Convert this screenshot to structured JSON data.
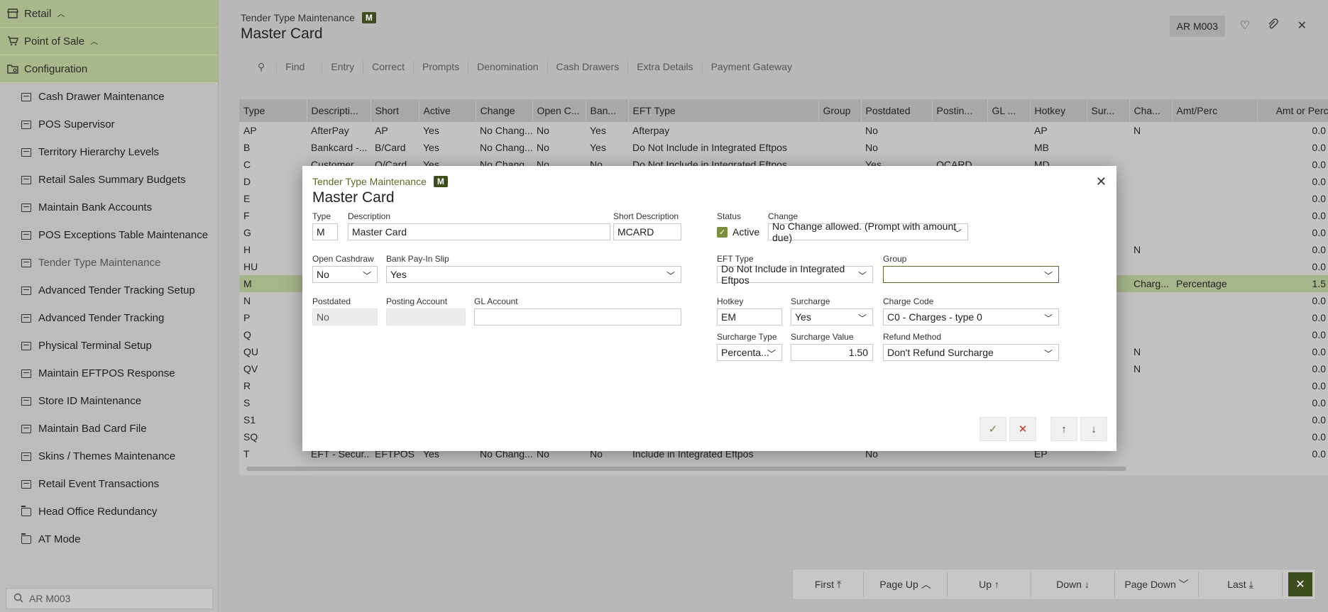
{
  "sidebar": {
    "groups": [
      {
        "label": "Retail",
        "icon": "store-icon",
        "chevron": "^"
      },
      {
        "label": "Point of Sale",
        "icon": "cart-icon",
        "chevron": "^"
      },
      {
        "label": "Configuration",
        "icon": "folder-gear-icon",
        "chevron": ""
      }
    ],
    "items": [
      "Cash Drawer Maintenance",
      "POS Supervisor",
      "Territory Hierarchy Levels",
      "Retail Sales Summary Budgets",
      "Maintain Bank Accounts",
      "POS Exceptions Table Maintenance",
      "Tender Type Maintenance",
      "Advanced Tender Tracking Setup",
      "Advanced Tender Tracking",
      "Physical Terminal Setup",
      "Maintain EFTPOS Response",
      "Store ID Maintenance",
      "Maintain Bad Card File",
      "Skins / Themes Maintenance",
      "Retail Event Transactions",
      "Head Office Redundancy",
      "AT Mode"
    ],
    "search_value": "AR M003"
  },
  "header": {
    "subtitle": "Tender Type Maintenance",
    "badge": "M",
    "title": "Master Card",
    "user": "AR M003"
  },
  "toolbar": [
    "Find",
    "Entry",
    "Correct",
    "Prompts",
    "Denomination",
    "Cash Drawers",
    "Extra Details",
    "Payment Gateway"
  ],
  "table": {
    "columns": [
      "Type",
      "Descripti...",
      "Short",
      "Active",
      "Change",
      "Open C...",
      "Ban...",
      "EFT Type",
      "Group",
      "Postdated",
      "Postin...",
      "GL ...",
      "Hotkey",
      "Sur...",
      "Cha...",
      "Amt/Perc",
      "Amt or Perc"
    ],
    "rows": [
      [
        "AP",
        "AfterPay",
        "AP",
        "Yes",
        "No Chang...",
        "No",
        "Yes",
        "Afterpay",
        "",
        "No",
        "",
        "",
        "AP",
        "",
        "N",
        "",
        "0.0"
      ],
      [
        "B",
        "Bankcard -...",
        "B/Card",
        "Yes",
        "No Chang...",
        "No",
        "Yes",
        "Do Not Include in Integrated Eftpos",
        "",
        "No",
        "",
        "",
        "MB",
        "",
        "",
        "",
        "0.0"
      ],
      [
        "C",
        "Customer...",
        "O/Card",
        "Yes",
        "No Chang...",
        "No",
        "No",
        "Do Not Include in Integrated Eftpos",
        "",
        "Yes",
        "OCARD",
        "",
        "MD",
        "",
        "",
        "",
        "0.0"
      ],
      [
        "D",
        "",
        "",
        "",
        "",
        "",
        "",
        "",
        "",
        "",
        "",
        "",
        "",
        "",
        "",
        "",
        "0.0"
      ],
      [
        "E",
        "",
        "",
        "",
        "",
        "",
        "",
        "",
        "",
        "",
        "",
        "",
        "",
        "",
        "",
        "",
        "0.0"
      ],
      [
        "F",
        "",
        "",
        "",
        "",
        "",
        "",
        "",
        "",
        "",
        "",
        "",
        "",
        "",
        "",
        "",
        "0.0"
      ],
      [
        "G",
        "",
        "",
        "",
        "",
        "",
        "",
        "",
        "",
        "",
        "",
        "",
        "",
        "",
        "",
        "",
        "0.0"
      ],
      [
        "H",
        "",
        "",
        "",
        "",
        "",
        "",
        "",
        "",
        "",
        "",
        "",
        "",
        "",
        "N",
        "",
        "0.0"
      ],
      [
        "HU",
        "",
        "",
        "",
        "",
        "",
        "",
        "",
        "",
        "",
        "",
        "",
        "",
        "",
        "",
        "",
        "0.0"
      ],
      [
        "M",
        "",
        "",
        "",
        "",
        "",
        "",
        "",
        "",
        "",
        "",
        "",
        "",
        "",
        "Charg...",
        "Percentage",
        "1.5"
      ],
      [
        "N",
        "",
        "",
        "",
        "",
        "",
        "",
        "",
        "",
        "",
        "",
        "",
        "",
        "",
        "",
        "",
        "0.0"
      ],
      [
        "P",
        "",
        "",
        "",
        "",
        "",
        "",
        "",
        "",
        "",
        "",
        "",
        "",
        "",
        "",
        "",
        "0.0"
      ],
      [
        "Q",
        "",
        "",
        "",
        "",
        "",
        "",
        "",
        "",
        "",
        "",
        "",
        "",
        "",
        "",
        "",
        "0.0"
      ],
      [
        "QU",
        "",
        "",
        "",
        "",
        "",
        "",
        "",
        "",
        "",
        "",
        "",
        "",
        "",
        "N",
        "",
        "0.0"
      ],
      [
        "QV",
        "",
        "",
        "",
        "",
        "",
        "",
        "",
        "",
        "",
        "",
        "",
        "",
        "",
        "N",
        "",
        "0.0"
      ],
      [
        "R",
        "",
        "",
        "",
        "",
        "",
        "",
        "",
        "",
        "",
        "",
        "",
        "",
        "",
        "",
        "",
        "0.0"
      ],
      [
        "S",
        "",
        "",
        "",
        "",
        "",
        "",
        "",
        "",
        "",
        "",
        "",
        "",
        "",
        "",
        "",
        "0.0"
      ],
      [
        "S1",
        "",
        "",
        "",
        "",
        "",
        "",
        "",
        "",
        "",
        "",
        "",
        "",
        "",
        "",
        "",
        "0.0"
      ],
      [
        "SQ",
        "",
        "",
        "",
        "",
        "",
        "",
        "",
        "",
        "",
        "",
        "",
        "",
        "",
        "",
        "",
        "0.0"
      ],
      [
        "T",
        "EFT - Secur...",
        "EFTPOS",
        "Yes",
        "No Chang...",
        "No",
        "No",
        "Include in Integrated Eftpos",
        "",
        "No",
        "",
        "",
        "EP",
        "",
        "",
        "",
        "0.0"
      ]
    ],
    "selected_index": 9
  },
  "modal": {
    "subtitle": "Tender Type Maintenance",
    "badge": "M",
    "title": "Master Card",
    "fields": {
      "type": {
        "label": "Type",
        "value": "M"
      },
      "description": {
        "label": "Description",
        "value": "Master Card"
      },
      "short_description": {
        "label": "Short Description",
        "value": "MCARD"
      },
      "status": {
        "label": "Status",
        "value": "Active"
      },
      "change": {
        "label": "Change",
        "value": "No Change allowed. (Prompt with amount due)"
      },
      "open_cashdraw": {
        "label": "Open Cashdraw",
        "value": "No"
      },
      "bank_payin": {
        "label": "Bank Pay-In Slip",
        "value": "Yes"
      },
      "eft_type": {
        "label": "EFT Type",
        "value": "Do Not Include in Integrated Eftpos"
      },
      "group": {
        "label": "Group",
        "value": ""
      },
      "postdated": {
        "label": "Postdated",
        "value": "No"
      },
      "posting_account": {
        "label": "Posting Account",
        "value": ""
      },
      "gl_account": {
        "label": "GL Account",
        "value": ""
      },
      "hotkey": {
        "label": "Hotkey",
        "value": "EM"
      },
      "surcharge": {
        "label": "Surcharge",
        "value": "Yes"
      },
      "charge_code": {
        "label": "Charge Code",
        "value": "C0 - Charges - type 0"
      },
      "surcharge_type": {
        "label": "Surcharge Type",
        "value": "Percenta..."
      },
      "surcharge_value": {
        "label": "Surcharge Value",
        "value": "1.50"
      },
      "refund_method": {
        "label": "Refund Method",
        "value": "Don't Refund Surcharge"
      }
    }
  },
  "pager": [
    "First",
    "Page Up",
    "Up",
    "Down",
    "Page Down",
    "Last"
  ],
  "colors": {
    "accent": "#3d4d1e",
    "selected_row": "#a7b58a",
    "sidebar_group": "#a9b88a"
  }
}
